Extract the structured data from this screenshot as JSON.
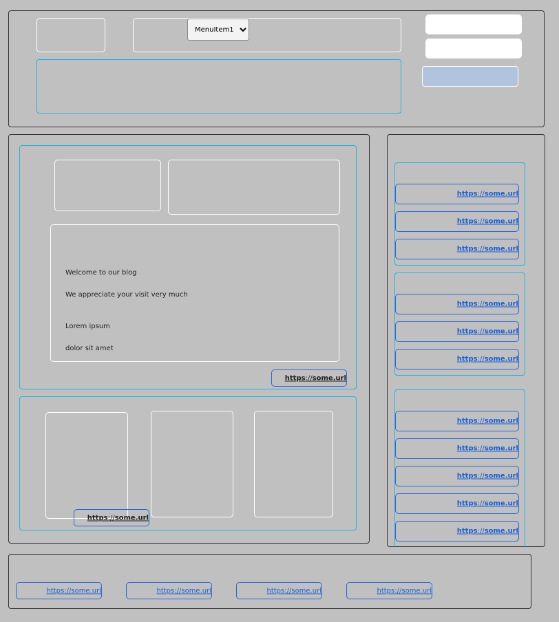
{
  "header": {
    "menu": {
      "selected": "MenuItem1",
      "options": [
        "MenuItem1"
      ]
    }
  },
  "blog": {
    "welcome": "Welcome to our blog",
    "appreciate": "We appreciate your visit very much",
    "lorem": "Lorem ipsum",
    "dolor": "dolor sit amet",
    "link": {
      "scheme": "https",
      "sep": "://",
      "host": "some.url"
    }
  },
  "gallery": {
    "link": {
      "scheme": "https",
      "sep": "://",
      "host": "some.url"
    }
  },
  "sidebar": {
    "link": {
      "scheme": "https",
      "sep": "://",
      "host": "some.url"
    }
  },
  "footer": {
    "link": {
      "scheme": "https",
      "sep": "://",
      "host": "some.url"
    }
  }
}
